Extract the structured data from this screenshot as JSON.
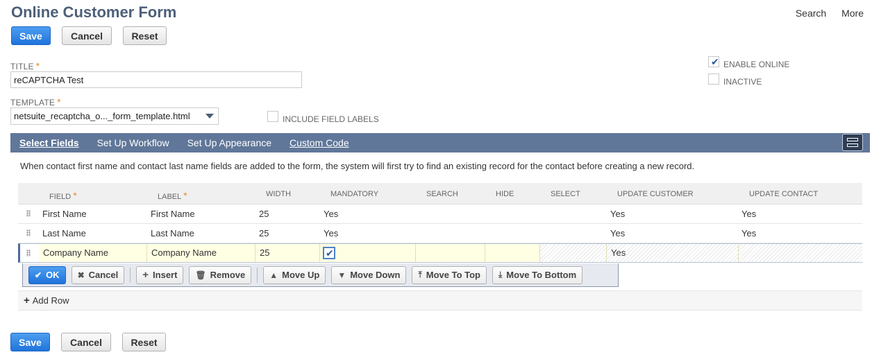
{
  "header": {
    "title": "Online Customer Form",
    "search": "Search",
    "more": "More"
  },
  "buttons": {
    "save": "Save",
    "cancel": "Cancel",
    "reset": "Reset"
  },
  "form": {
    "title_label": "TITLE",
    "title_value": "reCAPTCHA Test",
    "template_label": "TEMPLATE",
    "template_value": "netsuite_recaptcha_o..._form_template.html",
    "include_field_labels": "INCLUDE FIELD LABELS",
    "enable_online": "ENABLE ONLINE",
    "inactive": "INACTIVE",
    "required_mark": "*"
  },
  "tabs": [
    "Select Fields",
    "Set Up Workflow",
    "Set Up Appearance",
    "Custom Code"
  ],
  "info": "When contact first name and contact last name fields are added to the form, the system will first try to find an existing record for the contact before creating a new record.",
  "grid": {
    "headers": [
      "FIELD",
      "LABEL",
      "WIDTH",
      "MANDATORY",
      "SEARCH",
      "HIDE",
      "SELECT",
      "UPDATE CUSTOMER",
      "UPDATE CONTACT"
    ],
    "rows": [
      {
        "field": "First Name",
        "label": "First Name",
        "width": "25",
        "mandatory": "Yes",
        "update_customer": "Yes",
        "update_contact": "Yes"
      },
      {
        "field": "Last Name",
        "label": "Last Name",
        "width": "25",
        "mandatory": "Yes",
        "update_customer": "Yes",
        "update_contact": "Yes"
      }
    ],
    "edit_row": {
      "field": "Company Name",
      "label": "Company Name",
      "width": "25",
      "update_customer": "Yes"
    }
  },
  "actions": [
    "OK",
    "Cancel",
    "Insert",
    "Remove",
    "Move Up",
    "Move Down",
    "Move To Top",
    "Move To Bottom"
  ],
  "add_row": "Add Row",
  "colors": {
    "accent": "#607799",
    "primary": "#1f74db",
    "title": "#4d5f79",
    "required": "#e08e2c",
    "edit_bg": "#ffffe3"
  }
}
